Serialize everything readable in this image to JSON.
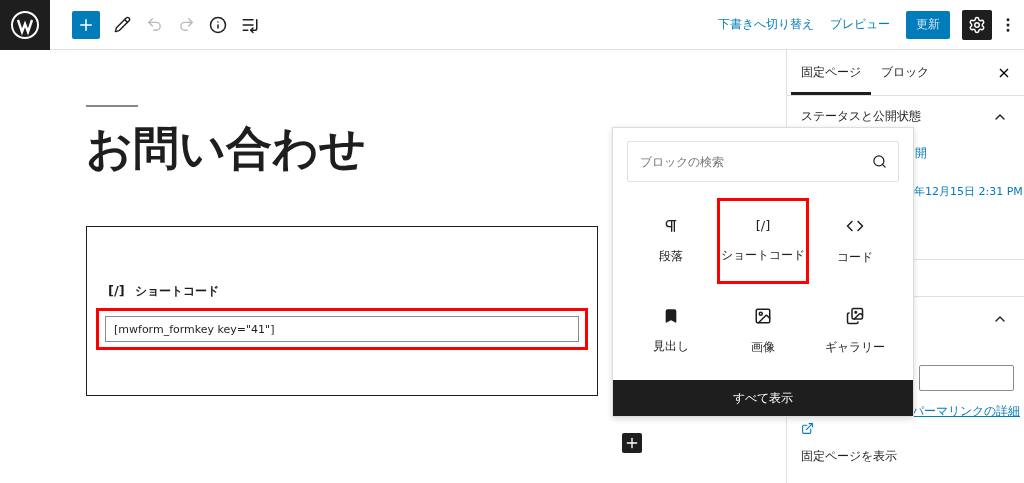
{
  "toolbar": {
    "actions": [
      "下書きへ切り替え",
      "プレビュー"
    ],
    "update_button": "更新",
    "settings_selected": true
  },
  "editor": {
    "title": "お問い合わせ",
    "shortcode_block": {
      "icon": "[/]",
      "label": "ショートコード",
      "value": "[mwform_formkey key=\"41\"]",
      "highlighted": true
    }
  },
  "inserter": {
    "placeholder": "ブロックの検索",
    "blocks": [
      {
        "kind": "paragraph",
        "label": "段落",
        "highlighted": false
      },
      {
        "kind": "shortcode",
        "icon": "[/]",
        "label": "ショートコード",
        "highlighted": true
      },
      {
        "kind": "code",
        "label": "コード",
        "highlighted": false
      },
      {
        "kind": "heading",
        "label": "見出し",
        "highlighted": false
      },
      {
        "kind": "image",
        "label": "画像",
        "highlighted": false
      },
      {
        "kind": "gallery",
        "label": "ギャラリー",
        "highlighted": false
      }
    ],
    "show_all": "すべて表示"
  },
  "sidebar": {
    "tabs": [
      {
        "label": "固定ページ",
        "selected": true
      },
      {
        "label": "ブロック",
        "selected": false
      }
    ],
    "close": "×",
    "status_panel": {
      "title": "ステータスと公開状態",
      "expanded": true,
      "visibility": "開",
      "publish_date": "年12月15日 2:31 PM"
    },
    "permalink_panel": {
      "expanded": true,
      "link": "パーマリンクの詳細",
      "view_page": "固定ページを表示"
    }
  }
}
